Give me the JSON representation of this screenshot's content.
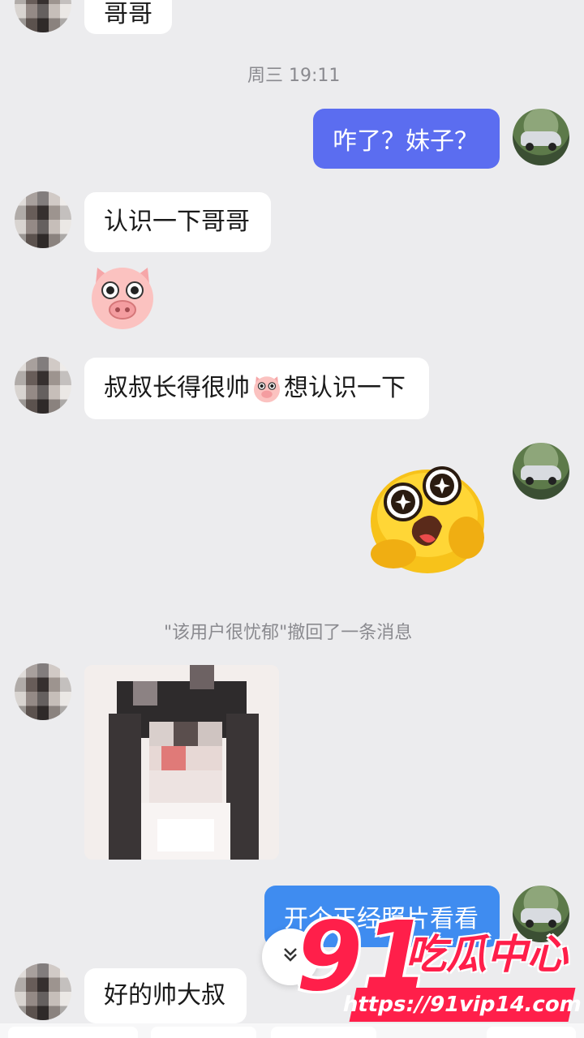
{
  "chat": {
    "timestamp": "周三 19:11",
    "messages": [
      {
        "side": "left",
        "text": "哥哥"
      },
      {
        "side": "right",
        "text": "咋了？妹子？"
      },
      {
        "side": "left",
        "text": "认识一下哥哥"
      },
      {
        "side": "left",
        "text": "叔叔长得很帅",
        "text_after": "想认识一下"
      },
      {
        "side": "right",
        "text": "开个正经照片看看"
      },
      {
        "side": "left",
        "text": "好的帅大叔"
      }
    ],
    "recall_notice": "\"该用户很忧郁\"撤回了一条消息"
  },
  "icons": {
    "pig": "pig-face-emoji-icon",
    "duck": "surprised-duck-sticker-icon",
    "scroll_down": "double-chevron-down-icon"
  },
  "watermark": {
    "number": "91",
    "name": "吃瓜中心",
    "url": "https://91vip14.com"
  },
  "colors": {
    "right_bubble": "#5b6df0",
    "background": "#ececee",
    "watermark": "#ff1f4a"
  }
}
